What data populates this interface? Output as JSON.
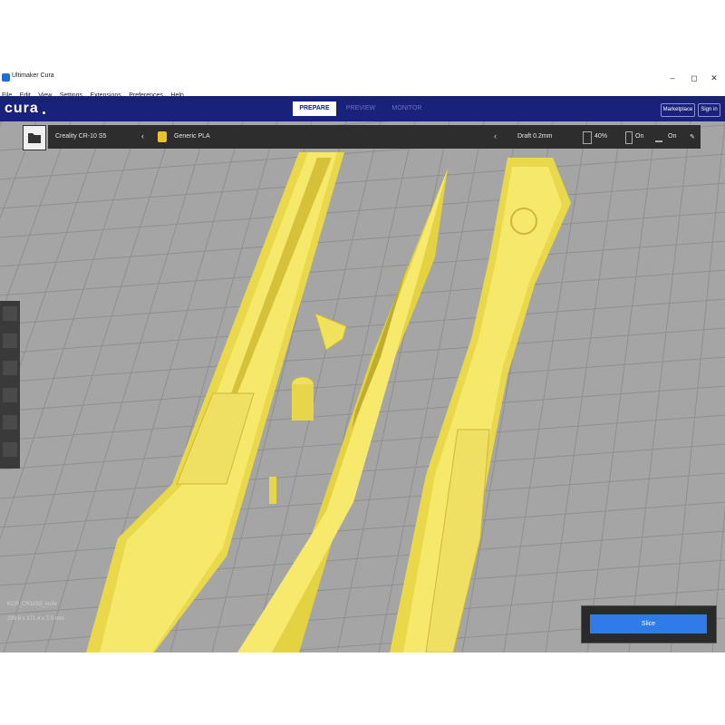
{
  "window": {
    "title": "Ultimaker Cura",
    "controls": [
      "–",
      "◻",
      "✕"
    ]
  },
  "menu": [
    "File",
    "Edit",
    "View",
    "Settings",
    "Extensions",
    "Preferences",
    "Help"
  ],
  "header": {
    "logo": "cura",
    "stages": [
      "PREPARE",
      "PREVIEW",
      "MONITOR"
    ],
    "active_stage": "PREPARE",
    "marketplace_label": "Marketplace",
    "signin_label": "Sign in"
  },
  "toolbar": {
    "printer": "Creality CR-10 S5",
    "material": "Generic PLA",
    "profile": "Draft 0.2mm",
    "infill": "40%",
    "support": "On",
    "adhesion": "On"
  },
  "viewport": {
    "object_name": "KCR_CR10S5_knife",
    "dimensions": "299.9 x 171.4 x 7.0 mm"
  },
  "slice_button": "Slice"
}
